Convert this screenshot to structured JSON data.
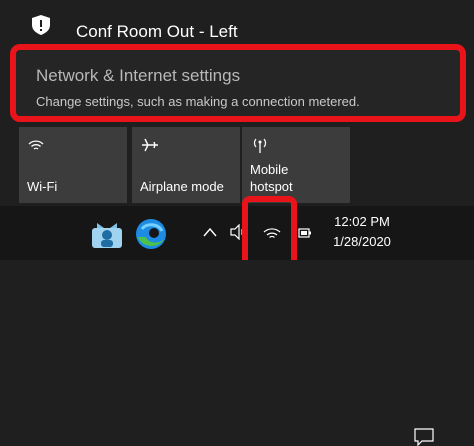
{
  "network": {
    "name": "Conf Room Out - Left"
  },
  "settings_link": {
    "title": "Network & Internet settings",
    "subtitle": "Change settings, such as making a connection metered."
  },
  "quick_actions": [
    {
      "label": "Wi-Fi",
      "icon": "wifi-icon"
    },
    {
      "label": "Airplane mode",
      "icon": "airplane-icon"
    },
    {
      "label_line1": "Mobile",
      "label_line2": "hotspot",
      "icon": "hotspot-icon"
    }
  ],
  "taskbar": {
    "time": "12:02 PM",
    "date": "1/28/2020",
    "icons": [
      "people-icon",
      "edge-icon",
      "chevron-up-icon",
      "volume-icon",
      "wifi-icon",
      "battery-icon",
      "notification-icon"
    ]
  },
  "colors": {
    "highlight": "#e8141a",
    "tile": "#3c3c3c",
    "background": "#1f1f1f",
    "taskbar": "#161616",
    "edge_blue": "#1e8ce3",
    "edge_green": "#4cc24a"
  }
}
